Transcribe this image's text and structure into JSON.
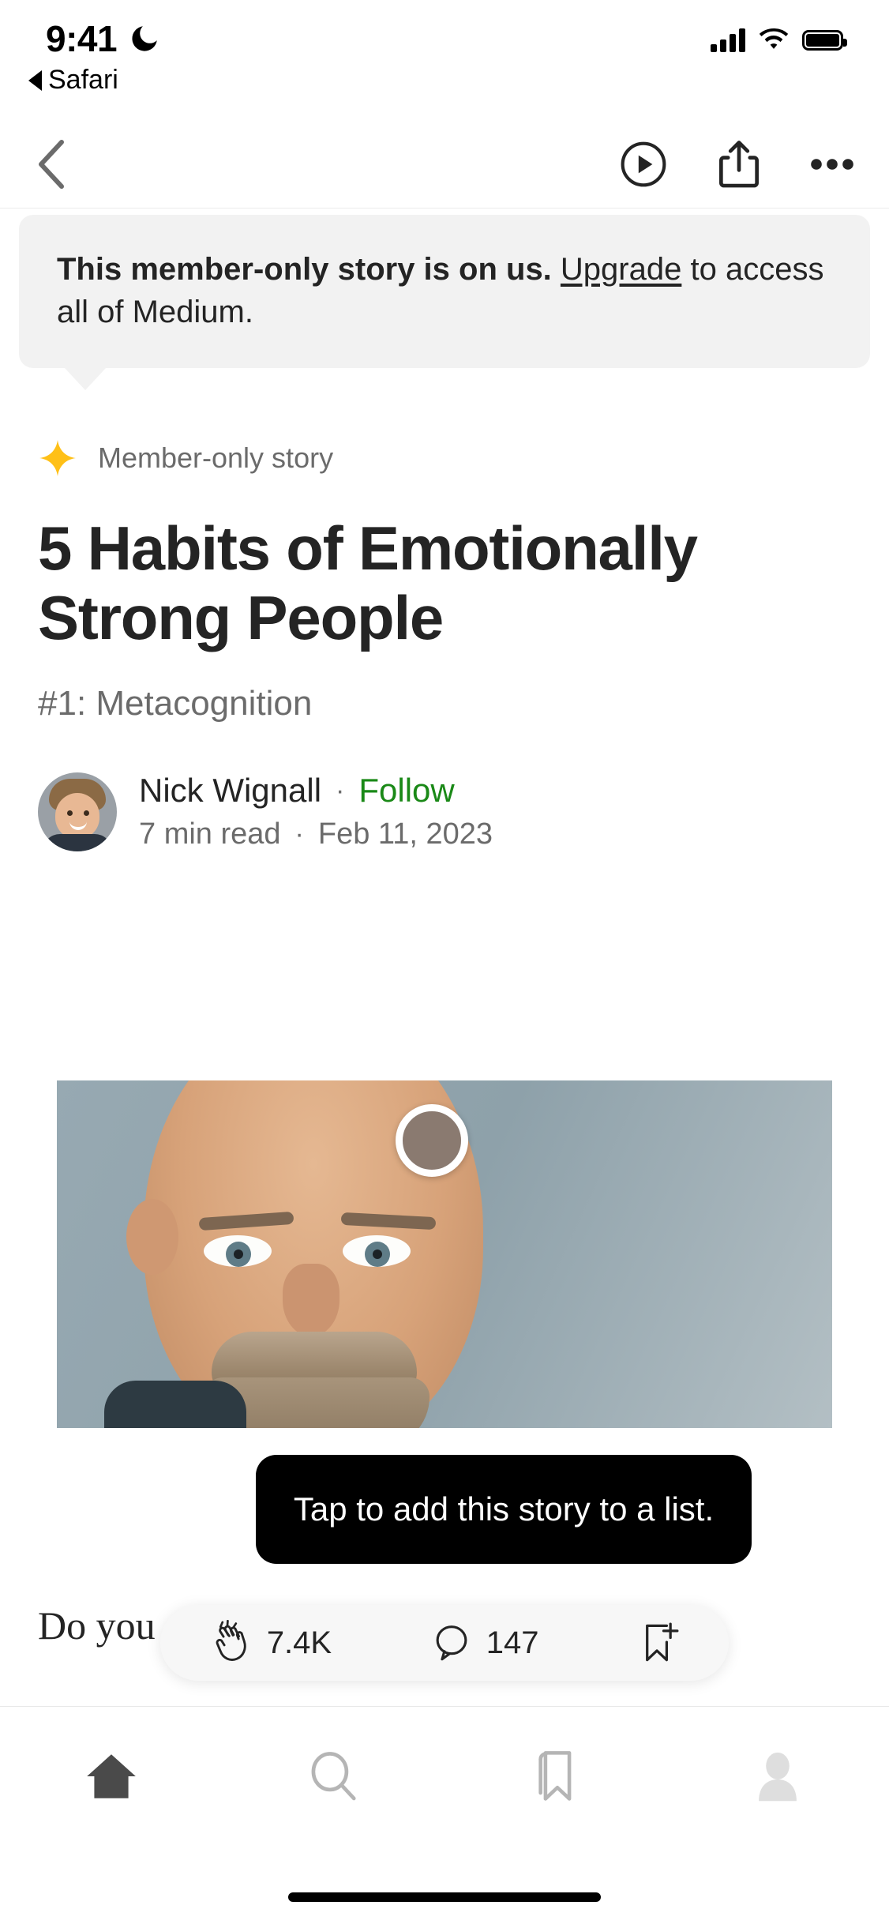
{
  "status_bar": {
    "time": "9:41",
    "dnd_icon": "moon-icon",
    "cellular_icon": "cellular-signal-icon",
    "wifi_icon": "wifi-icon",
    "battery_icon": "battery-full-icon"
  },
  "back_to_app": {
    "label": "Safari",
    "icon": "back-triangle-icon"
  },
  "nav_bar": {
    "back_icon": "chevron-left-icon",
    "listen_icon": "play-circle-icon",
    "share_icon": "share-up-icon",
    "more_icon": "ellipsis-icon"
  },
  "banner": {
    "bold_text": "This member-only story is on us.",
    "link_text": "Upgrade",
    "rest_text": " to access all of Medium."
  },
  "article": {
    "member_badge": {
      "icon": "star-sparkle-icon",
      "label": "Member-only story"
    },
    "title": "5 Habits of Emotionally Strong People",
    "subtitle": "#1: Metacognition",
    "author": {
      "name": "Nick Wignall",
      "separator": "·",
      "follow_label": "Follow",
      "read_time": "7  min read",
      "date": "Feb 11, 2023",
      "avatar": "author-avatar"
    },
    "hero_image_alt": "bald-man-with-mustache-photo",
    "body_excerpt": "Do you                                                    s are"
  },
  "coach_tooltip": {
    "text": "Tap to add this story to a list."
  },
  "action_pill": {
    "clap": {
      "icon": "clap-icon",
      "count": "7.4K"
    },
    "comment": {
      "icon": "comment-bubble-icon",
      "count": "147"
    },
    "add_to_list": {
      "icon": "bookmark-plus-icon"
    }
  },
  "tab_bar": {
    "items": [
      {
        "name": "home",
        "icon": "home-icon",
        "active": true
      },
      {
        "name": "search",
        "icon": "search-icon",
        "active": false
      },
      {
        "name": "library",
        "icon": "bookmark-icon",
        "active": false
      },
      {
        "name": "profile",
        "icon": "person-icon",
        "active": false
      }
    ]
  },
  "colors": {
    "accent_green": "#1a8917",
    "member_star": "#FFC017",
    "text_primary": "#242424",
    "text_secondary": "#6b6b6b",
    "banner_bg": "#f2f2f2",
    "tooltip_bg": "#000000"
  }
}
